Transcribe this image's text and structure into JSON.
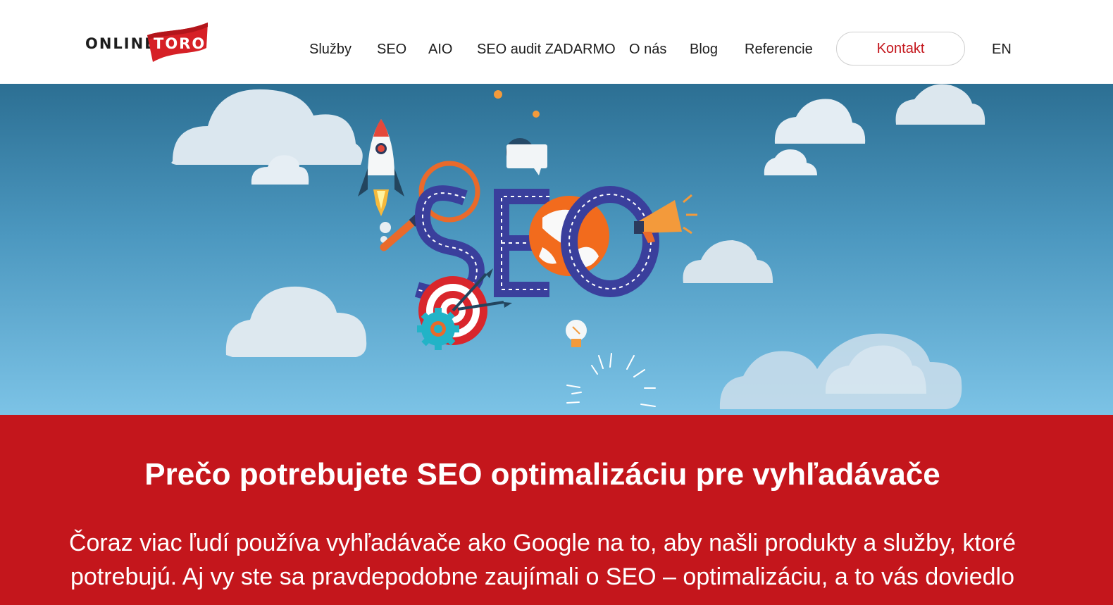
{
  "brand": {
    "logo_left": "ONLINE",
    "logo_right": "TORO",
    "accent_color": "#c4161c"
  },
  "nav": {
    "items": [
      {
        "label": "Služby"
      },
      {
        "label": "SEO"
      },
      {
        "label": "AIO"
      },
      {
        "label": "SEO audit ZADARMO"
      },
      {
        "label": "O nás"
      },
      {
        "label": "Blog"
      },
      {
        "label": "Referencie"
      }
    ],
    "contact_label": "Kontakt",
    "language_label": "EN"
  },
  "hero": {
    "illustration_text": "SEO",
    "icons": [
      "rocket-icon",
      "magnifier-icon",
      "globe-icon",
      "megaphone-icon",
      "target-icon",
      "gear-icon",
      "lightbulb-icon",
      "speech-bubble-icon",
      "cloud-icon"
    ]
  },
  "intro": {
    "heading": "Prečo potrebujete SEO optimalizáciu pre vyhľadávače",
    "paragraph": "Čoraz viac ľudí používa vyhľadávače ako Google na to, aby našli produkty a služby, ktoré potrebujú. Aj vy ste sa pravdepodobne zaujímali o SEO – optimalizáciu, a to vás doviedlo"
  }
}
